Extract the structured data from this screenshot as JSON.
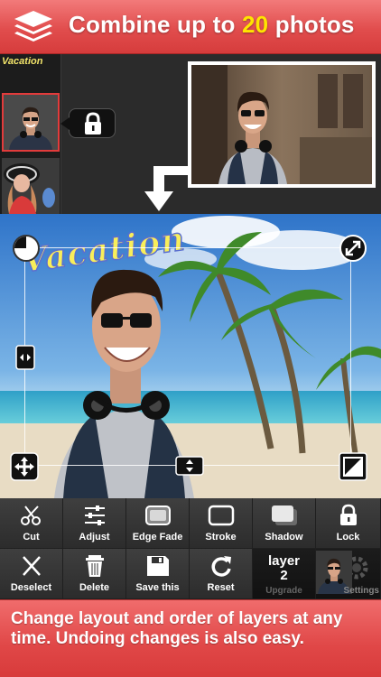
{
  "banner": {
    "title_pre": "Combine up to ",
    "title_highlight": "20",
    "title_post": " photos",
    "icon": "layers-icon"
  },
  "editor": {
    "thumbnail_label": "Vacation",
    "lock_icon": "lock-icon",
    "canvas_text": "Vacation"
  },
  "toolbar": {
    "row1": [
      {
        "label": "Cut",
        "icon": "scissors-icon"
      },
      {
        "label": "Adjust",
        "icon": "sliders-icon"
      },
      {
        "label": "Edge Fade",
        "icon": "edge-fade-icon"
      },
      {
        "label": "Stroke",
        "icon": "stroke-icon"
      },
      {
        "label": "Shadow",
        "icon": "shadow-icon"
      },
      {
        "label": "Lock",
        "icon": "lock-icon"
      }
    ],
    "row2": [
      {
        "label": "Deselect",
        "icon": "close-icon"
      },
      {
        "label": "Delete",
        "icon": "trash-icon"
      },
      {
        "label": "Save this",
        "icon": "save-icon"
      },
      {
        "label": "Reset",
        "icon": "reset-icon"
      }
    ],
    "layer_label": "layer",
    "layer_number": "2",
    "upgrade_label": "Upgrade",
    "settings_label": "Settings"
  },
  "footer": {
    "text": "Change layout and order of layers at any time. Undoing changes is also easy."
  },
  "colors": {
    "banner_red": "#e14d4d",
    "highlight_yellow": "#ffe400",
    "selection_red": "#e23b3b"
  }
}
